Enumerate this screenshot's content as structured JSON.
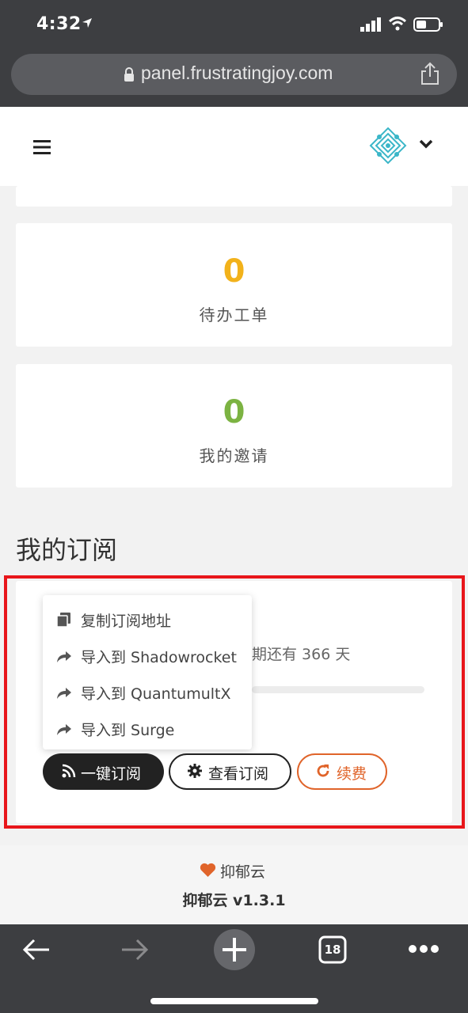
{
  "status_bar": {
    "time": "4:32",
    "icons": [
      "location-arrow-icon",
      "signal-icon",
      "wifi-icon",
      "battery-icon"
    ]
  },
  "browser": {
    "url": "panel.frustratingjoy.com",
    "tab_count": "18",
    "toolbar_icons": [
      "back-arrow-icon",
      "forward-arrow-icon",
      "new-tab-plus-icon",
      "tabs-icon",
      "more-icon"
    ]
  },
  "header": {
    "menu_icon": "hamburger-icon",
    "avatar_icon": "avatar-pattern-icon",
    "caret_icon": "chevron-down-icon"
  },
  "stats": [
    {
      "value": "0",
      "label": "待办工单",
      "color": "#f2b21b"
    },
    {
      "value": "0",
      "label": "我的邀请",
      "color": "#7cb342"
    }
  ],
  "subscription": {
    "section_title": "我的订阅",
    "expiry_text": "期还有 366 天",
    "dropdown": [
      {
        "icon": "copy-icon",
        "label": "复制订阅地址"
      },
      {
        "icon": "share-arrow-icon",
        "label": "导入到 Shadowrocket"
      },
      {
        "icon": "share-arrow-icon",
        "label": "导入到 QuantumultX"
      },
      {
        "icon": "share-arrow-icon",
        "label": "导入到 Surge"
      }
    ],
    "buttons": {
      "subscribe": "一键订阅",
      "view": "查看订阅",
      "renew": "续费"
    },
    "highlight_color": "#e8161b",
    "renew_color": "#e0642a"
  },
  "footer": {
    "brand": "抑郁云",
    "version": "抑郁云 v1.3.1",
    "heart_color": "#e0642a"
  }
}
